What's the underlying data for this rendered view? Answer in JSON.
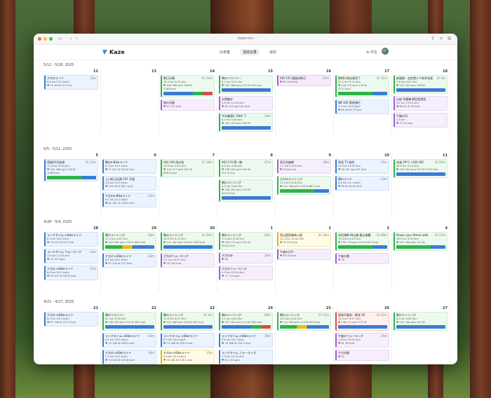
{
  "browser": {
    "url": "kaze.run"
  },
  "app": {
    "name": "Kaze"
  },
  "nav": {
    "items": [
      "仪表盘",
      "活动记录",
      "目的"
    ],
    "active_index": 1
  },
  "lang": {
    "label": "中文"
  },
  "weeks": [
    {
      "label": "5/12 - 5/18, 2025",
      "days": [
        {
          "num": "12",
          "cards": [
            {
              "kind": "ride",
              "title": "夕方のライド",
              "dur": "23m",
              "l1": "8.8 km  15.5 km/h",
              "l2": "♥ 91  46 W  117 kcal"
            }
          ]
        },
        {
          "num": "13",
          "cards": []
        },
        {
          "num": "14",
          "cards": [
            {
              "kind": "run",
              "title": "朝日天晴",
              "dur": "1h 16m",
              "l1": "15.3 km  4:55 /km",
              "l2": "♥ 146  166 spm  238 W",
              "l3": "1163 kcal",
              "strip": "r"
            },
            {
              "kind": "walk",
              "title": "夜のお散",
              "dur": "",
              "l1": "",
              "l2": "♥ 82  171 kcal"
            }
          ]
        },
        {
          "num": "15",
          "cards": [
            {
              "kind": "run",
              "title": "朝のリカバリー",
              "dur": "",
              "l1": "6.1 km  5:21 /km",
              "l2": "♥ 135  166 spm  223 W  474 kcal",
              "strip": "b"
            },
            {
              "kind": "walk",
              "title": "お昼散歩",
              "dur": "",
              "l1": "1.6 km  11:00 /km",
              "l2": "♥ 82  112 spm  82 kcal"
            },
            {
              "kind": "run",
              "title": "今年最速2 1000 了",
              "dur": "29m",
              "l1": "5.0 km  5:48 /km",
              "l2": "♥ 150  159 spm  264 W",
              "l3": "",
              "strip": "b"
            }
          ]
        },
        {
          "num": "16",
          "cards": [
            {
              "kind": "aqi",
              "title": "AQI 155 超级训练日",
              "dur": "22m",
              "l1": "",
              "l2": "♥ 85  154 kcal"
            }
          ]
        },
        {
          "num": "17",
          "cards": [
            {
              "kind": "run",
              "title": "朝明け前出発完了",
              "dur": "1h 51m",
              "l1": "21.2 km  5:14 /km",
              "l2": "♥ 139  170 spm  220 W",
              "l3": "1727 kcal",
              "strip": "g"
            },
            {
              "kind": "ride",
              "title": "NB 104 简易骑行",
              "dur": "",
              "l1": "3.2 km  12.8 km/h",
              "l2": "♥ 84  46 W  75 kcal"
            }
          ]
        },
        {
          "num": "18",
          "cards": [
            {
              "kind": "run",
              "title": "疾風跑・定定第二个前并务速",
              "dur": "1h 4m",
              "l1": "7.8 km  5:47 /km",
              "l2": "♥ 132  159 spm  208 W",
              "strip": "b"
            },
            {
              "kind": "walk",
              "title": "山坂·早晨練·朝回程提定",
              "dur": "",
              "l1": "4.2 km  15:45 /km",
              "l2": "♥ 88  61 W  55 kcal"
            },
            {
              "kind": "walk",
              "title": "午後の河",
              "dur": "",
              "l1": "1.5 km",
              "l2": "♥ 72  29 kcal"
            }
          ]
        }
      ]
    },
    {
      "label": "5/5 - 5/11, 2025",
      "days": [
        {
          "num": "5",
          "cards": [
            {
              "kind": "ride",
              "title": "国道24号疾驰",
              "dur": "1h 13m",
              "l1": "15.4 km  3:04 /km",
              "l2": "♥ 130  186 spm  226 W",
              "l3": "1046 kcal",
              "strip": "g"
            }
          ]
        },
        {
          "num": "6",
          "cards": [
            {
              "kind": "ride",
              "title": "朝のe-Bikeライド",
              "dur": "",
              "l1": "6.3 km  24.7 km/h",
              "l2": "♥ 71  227 W  226.6 kcal"
            },
            {
              "kind": "ride",
              "title": "上川紅日出港 207 天候",
              "dur": "",
              "l1": "4.8 km  14.0 km/h",
              "l2": "♥ 104  90 W  96.1 kcal"
            },
            {
              "kind": "ride",
              "title": "夕方のe-Bikeライド",
              "dur": "23m",
              "l1": "6.1 km  22.2 km/h",
              "l2": "♥ 82  181 W  136.5 kcal"
            }
          ]
        },
        {
          "num": "7",
          "cards": [
            {
              "kind": "run",
              "title": "AQI 109 雨水机",
              "dur": "1h 16m",
              "l1": "13.0 km  5:55 /km",
              "l2": "♥ 144  177 spm  231 W",
              "l3": "898.3 kcal"
            }
          ]
        },
        {
          "num": "8",
          "cards": [
            {
              "kind": "run",
              "title": "AQI 174 第一階",
              "dur": "47m",
              "l1": "8.5 km  5:26 /km",
              "l2": "♥ 138  162 spm  243 W",
              "l3": "551.5 kcal"
            },
            {
              "kind": "run",
              "title": "朝のランニング",
              "dur": "",
              "l1": "6.2 km  5:06 /km",
              "l2": "♥ 128  160 spm  223 W",
              "l3": "442.8 kcal",
              "strip": "b"
            }
          ]
        },
        {
          "num": "9",
          "cards": [
            {
              "kind": "walk",
              "title": "雨天利爽朗",
              "dur": "18m",
              "l1": "1.7 km  11:00 /km",
              "l2": "♥ 93  26 kcal"
            },
            {
              "kind": "run",
              "title": "夕方のランニング",
              "dur": "",
              "l1": "11.0 km  4:56 /km",
              "l2": "♥ 151  186 spm  234 W  867 kcal",
              "strip": "g"
            }
          ]
        },
        {
          "num": "10",
          "cards": [
            {
              "kind": "ride",
              "title": "再見 T1 組件",
              "dur": "15m",
              "l1": "5.0 km  10:43 /km",
              "l2": "♥ 94  131 spm  87 kcal"
            },
            {
              "kind": "ride",
              "title": "朝のライド",
              "dur": "23m",
              "l1": "6.4 km  15.1 km/h",
              "l2": "♥ 93  45 W  62 kcal"
            }
          ]
        },
        {
          "num": "11",
          "cards": [
            {
              "kind": "run",
              "title": "米渡 29°C / AQI 182",
              "dur": "1h 26m",
              "l1": "16.5 km  5:15 /km",
              "l2": "♥ 129  162 spm  237 W  1152 kcal",
              "strip": "b"
            }
          ]
        }
      ]
    },
    {
      "label": "4/28 - 5/4, 2025",
      "days": [
        {
          "num": "28",
          "cards": [
            {
              "kind": "ride",
              "title": "ランチタイム e-Bikeライド",
              "dur": "",
              "l1": "6.3 km  34.6 km/h",
              "l2": "♥ 74  222 W  207 kcal"
            },
            {
              "kind": "ride",
              "title": "ランチタイム ウォーキング",
              "dur": "24m",
              "l1": "1.8 km  11:43 /km",
              "l2": "♥ 74  113 spm"
            },
            {
              "kind": "ride",
              "title": "夕方の e-Bikeライド",
              "dur": "15m",
              "l1": "8.8 km  35.0 km/h",
              "l2": "♥ 76  197 W  239.8 kcal"
            }
          ]
        },
        {
          "num": "29",
          "cards": [
            {
              "kind": "run",
              "title": "朝のランニング",
              "dur": "58m",
              "l1": "12.3 km  4:45 /km",
              "l2": "♥ 143  166 spm  250 W  862 kcal",
              "strip": ""
            },
            {
              "kind": "ride",
              "title": "夕方の e-Bikeライド",
              "dur": "16m",
              "l1": "6.3 km  16.2 km/h",
              "l2": "♥ 91  100 W  137 kcal"
            }
          ]
        },
        {
          "num": "30",
          "cards": [
            {
              "kind": "run",
              "title": "朝のランニング",
              "dur": "1h 20m",
              "l1": "16.5 km  5:12 /km",
              "l2": "♥ 147  182 spm  229 W  1283 kcal",
              "strip": "b"
            },
            {
              "kind": "walk",
              "title": "夕方のウォーキング",
              "dur": "",
              "l1": "5.1 km  10:52 /km",
              "l2": "♥ 78  124 kcal"
            }
          ]
        },
        {
          "num": "1",
          "cards": [
            {
              "kind": "run",
              "title": "朝のランニング",
              "dur": "58m",
              "l1": "11.2 km  5:18 /km",
              "l2": "♥ 143  172 spm  221 W",
              "l3": "904.9 kcal"
            },
            {
              "kind": "walk",
              "title": "夕方の歩",
              "dur": "26m",
              "l1": "",
              "l2": "♥ 84"
            },
            {
              "kind": "walk",
              "title": "夕方のウォーキング",
              "dur": "",
              "l1": "4.3 km  10:30 /km",
              "l2": "♥ 77  115 spm"
            }
          ]
        },
        {
          "num": "2",
          "cards": [
            {
              "kind": "hike",
              "title": "西山国家森林公園",
              "dur": "3h 10m",
              "l1": "12.1 km  15:42 /km",
              "l2": "♥ 95  376 kcal"
            },
            {
              "kind": "walk",
              "title": "午後の日午",
              "dur": "",
              "l1": "",
              "l2": "♥ 89  16 kcal"
            }
          ]
        },
        {
          "num": "3",
          "cards": [
            {
              "kind": "run",
              "title": "永恒湖畔·四山路·秦山南麓",
              "dur": "1h 48m",
              "l1": "15.6 km  5:42 /km",
              "l2": "♥ 135  174 spm  215 W  875 kcal",
              "strip": "g"
            },
            {
              "kind": "walk",
              "title": "午後の散",
              "dur": "",
              "l1": "",
              "l2": "♥ 76"
            }
          ]
        },
        {
          "num": "4",
          "cards": [
            {
              "kind": "run",
              "title": "Power your Stress with",
              "dur": "1h 23m",
              "l1": "16.5 km  5:05 /km",
              "l2": "♥ 137  166 spm  221 W",
              "strip": "g"
            }
          ]
        }
      ]
    },
    {
      "label": "4/21 - 4/27, 2025",
      "days": [
        {
          "num": "21",
          "cards": [
            {
              "kind": "ride",
              "title": "夕方の e-Bikeライド",
              "dur": "",
              "l1": "6.4 km  23.0 km/h",
              "l2": "♥ 87  196 W  197.9 kcal"
            }
          ]
        },
        {
          "num": "22",
          "cards": [
            {
              "kind": "run",
              "title": "朝のリカバリー",
              "dur": "",
              "l1": "8.0 km  5:33 /km",
              "l2": "♥ 138  162 spm  215 W  461 kcal",
              "strip": "b"
            },
            {
              "kind": "ride",
              "title": "ランチタイム e-Bikeライド",
              "dur": "16m",
              "l1": "6.3 km  29.0 km/h",
              "l2": "♥ 75  196 W  208.3 kcal"
            },
            {
              "kind": "ride",
              "title": "夕方の e-Bikeライド",
              "dur": "16m",
              "l1": "7.3 km  23.0 km/h",
              "l2": "♥ 74  216 W  243.6 kcal"
            }
          ]
        },
        {
          "num": "23",
          "cards": [
            {
              "kind": "run",
              "title": "朝のランニング",
              "dur": "1h 4m",
              "l1": "13.0 km  4:57 /km",
              "l2": "♥ 141  166 spm  228 W  954 kcal",
              "strip": "b"
            },
            {
              "kind": "ride",
              "title": "ランチタイム e-Bikeライド",
              "dur": "",
              "l1": "6.2 km  25.6 km/h",
              "l2": "♥ 74  168 W  206.2 kcal"
            },
            {
              "kind": "hike",
              "title": "夕方の e-Bikeライド",
              "dur": "15m",
              "l1": "6.9 km  25.4 km/h",
              "l2": "♥ 76  181 W  218.1 kcal"
            }
          ]
        },
        {
          "num": "24",
          "cards": [
            {
              "kind": "run",
              "title": "朝のランニング",
              "dur": "58m",
              "l1": "2.5 km  4:50 /km",
              "l2": "♥ 137  164 spm  214 W  788 kcal",
              "strip": "r"
            },
            {
              "kind": "ride",
              "title": "ランチタイム e-Bikeライド",
              "dur": "16m",
              "l1": "6.4 km  24.1 km/h",
              "l2": "♥ 76  188 W  195.5 kcal"
            },
            {
              "kind": "ride",
              "title": "ランチタイム ウォーキング",
              "dur": "",
              "l1": "1.3 km  12:24 /km",
              "l2": "♥ 82  114 spm"
            }
          ]
        },
        {
          "num": "25",
          "cards": [
            {
              "kind": "run",
              "title": "朝のランニング",
              "dur": "1h 11m",
              "l1": "14.4 km  4:52 /km",
              "l2": "♥ 142  166 spm  215 W  920 kcal",
              "strip": ""
            }
          ]
        },
        {
          "num": "26",
          "cards": [
            {
              "kind": "red",
              "title": "夏島不要前・断党 5K",
              "dur": "1h 22m",
              "l1": "14.2 km  5:07 /km",
              "l2": "♥ 146  171 spm  215 W",
              "strip": "b"
            },
            {
              "kind": "walk",
              "title": "午後のウォーキング",
              "dur": "25m",
              "l1": "1.8 km  10:45 /km",
              "l2": "♥ 81  38 kcal"
            },
            {
              "kind": "walk",
              "title": "夕方の散",
              "dur": "",
              "l1": "",
              "l2": "♥ 54"
            }
          ]
        },
        {
          "num": "27",
          "cards": [
            {
              "kind": "run",
              "title": "朝のランニング",
              "dur": "",
              "l1": "6.0 km  5:05 /km",
              "l2": "♥ 132  166 spm  241 W",
              "strip": "b"
            }
          ]
        }
      ]
    }
  ]
}
